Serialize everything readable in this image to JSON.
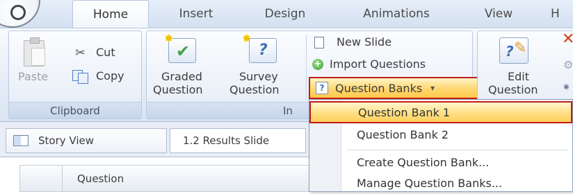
{
  "tabs": [
    {
      "label": "Home",
      "active": true
    },
    {
      "label": "Insert"
    },
    {
      "label": "Design"
    },
    {
      "label": "Animations"
    },
    {
      "label": "View"
    },
    {
      "label": "H"
    }
  ],
  "ribbon": {
    "clipboard": {
      "paste_label": "Paste",
      "cut_label": "Cut",
      "copy_label": "Copy",
      "group_label": "Clipboard"
    },
    "insert_group": {
      "graded_line1": "Graded",
      "graded_line2": "Question",
      "survey_line1": "Survey",
      "survey_line2": "Question",
      "group_label": "In"
    },
    "slide_group": {
      "new_slide_label": "New Slide",
      "import_label": "Import Questions",
      "question_banks_label": "Question Banks",
      "question_banks_arrow": "▾"
    },
    "edit_group": {
      "edit_line1": "Edit",
      "edit_line2": "Question"
    }
  },
  "lower_pane": {
    "story_view_label": "Story View",
    "results_slide_label": "1.2 Results Slide",
    "grid_header_label": "Question"
  },
  "dropdown": {
    "items": [
      {
        "label": "Question Bank 1",
        "selected": true
      },
      {
        "label": "Question Bank 2"
      },
      {
        "label": "Create Question Bank..."
      },
      {
        "label": "Manage Question Banks..."
      }
    ]
  },
  "colors": {
    "highlight_border": "#c21a1a",
    "hover_fill": "#ffd770",
    "ribbon_bg": "#e4ecf7"
  }
}
